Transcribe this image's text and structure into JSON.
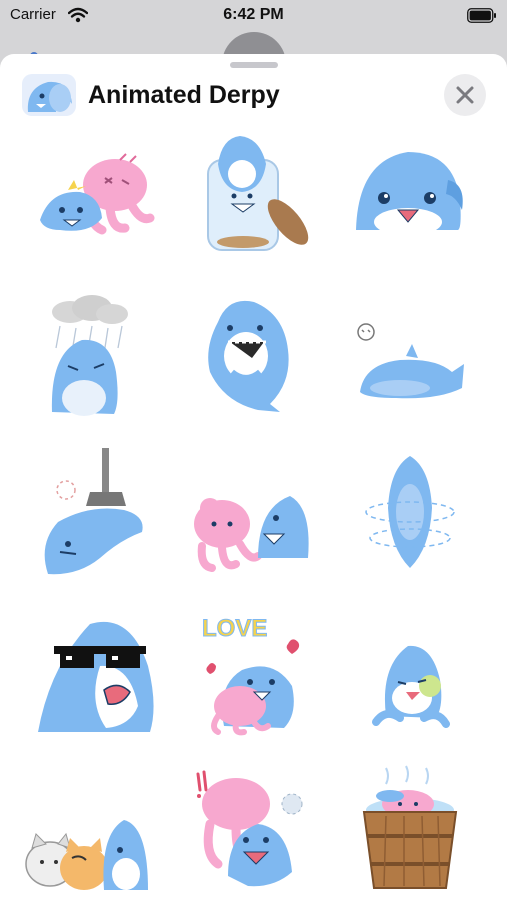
{
  "status_bar": {
    "carrier": "Carrier",
    "time": "6:42 PM",
    "wifi_icon": "wifi-icon",
    "battery_icon": "battery-icon"
  },
  "header": {
    "title": "Animated Derpy",
    "app_icon": "sticker-pack-icon",
    "close_icon": "close-icon"
  },
  "colors": {
    "shark_blue": "#7fb8f0",
    "octopus_pink": "#f7a8cf",
    "sheet_background": "#ffffff",
    "dim_background": "#d5d5d7"
  },
  "stickers": [
    {
      "name": "sticker-hug-octopus",
      "kind": "shark-octopus"
    },
    {
      "name": "sticker-cookie-jar",
      "kind": "jar"
    },
    {
      "name": "sticker-peek-smile",
      "kind": "face"
    },
    {
      "name": "sticker-rain-cloud",
      "kind": "rain"
    },
    {
      "name": "sticker-eating-fish",
      "kind": "curled"
    },
    {
      "name": "sticker-dead-lying",
      "kind": "lying"
    },
    {
      "name": "sticker-mop-hanging",
      "kind": "mop"
    },
    {
      "name": "sticker-octopus-friend",
      "kind": "octopus-shark"
    },
    {
      "name": "sticker-spinning",
      "kind": "spin"
    },
    {
      "name": "sticker-sunglasses",
      "kind": "shades"
    },
    {
      "name": "sticker-love",
      "kind": "love"
    },
    {
      "name": "sticker-eating-cookie",
      "kind": "sitting"
    },
    {
      "name": "sticker-cat-friends",
      "kind": "cats"
    },
    {
      "name": "sticker-octopus-surprise",
      "kind": "octopus-shark2"
    },
    {
      "name": "sticker-hot-tub",
      "kind": "tub"
    }
  ]
}
